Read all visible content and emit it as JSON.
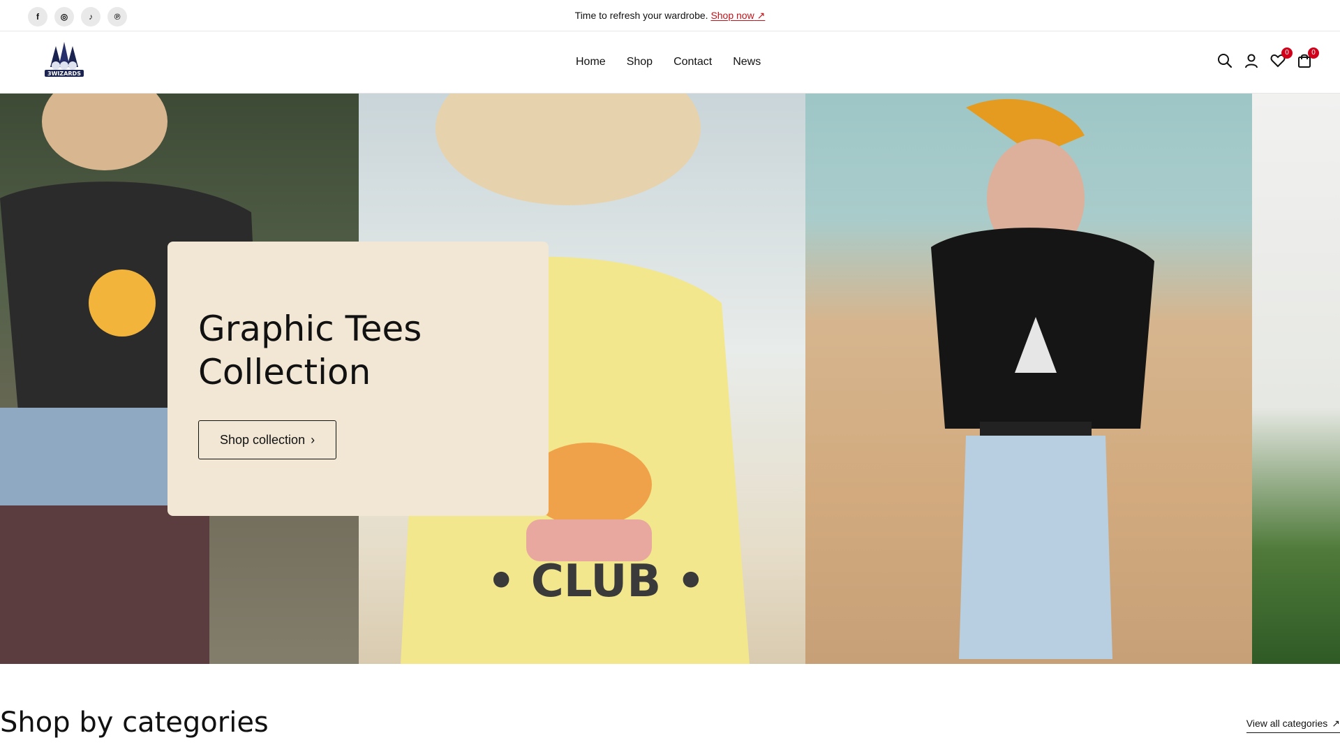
{
  "topbar": {
    "socials": [
      {
        "icon": "facebook-icon",
        "glyph": "f"
      },
      {
        "icon": "instagram-icon",
        "glyph": "◎"
      },
      {
        "icon": "tiktok-icon",
        "glyph": "♪"
      },
      {
        "icon": "pinterest-icon",
        "glyph": "℗"
      }
    ],
    "announcement_text": "Time to refresh your wardrobe.",
    "announcement_link": "Shop now",
    "announcement_link_arrow": "↗"
  },
  "header": {
    "logo_text": "3WIZARDS",
    "nav": [
      "Home",
      "Shop",
      "Contact",
      "News"
    ],
    "wishlist_count": "0",
    "cart_count": "0",
    "icons": [
      "search-icon",
      "account-icon",
      "wishlist-icon",
      "cart-icon"
    ]
  },
  "hero": {
    "title": "Graphic Tees Collection",
    "button_label": "Shop collection",
    "button_chevron": "›",
    "colors": {
      "promo_bg": "#f1e7d4",
      "badge": "#d0021b",
      "link": "#c4121a"
    }
  },
  "categories": {
    "title": "Shop by categories",
    "view_all_label": "View all categories",
    "view_all_arrow": "↗"
  }
}
